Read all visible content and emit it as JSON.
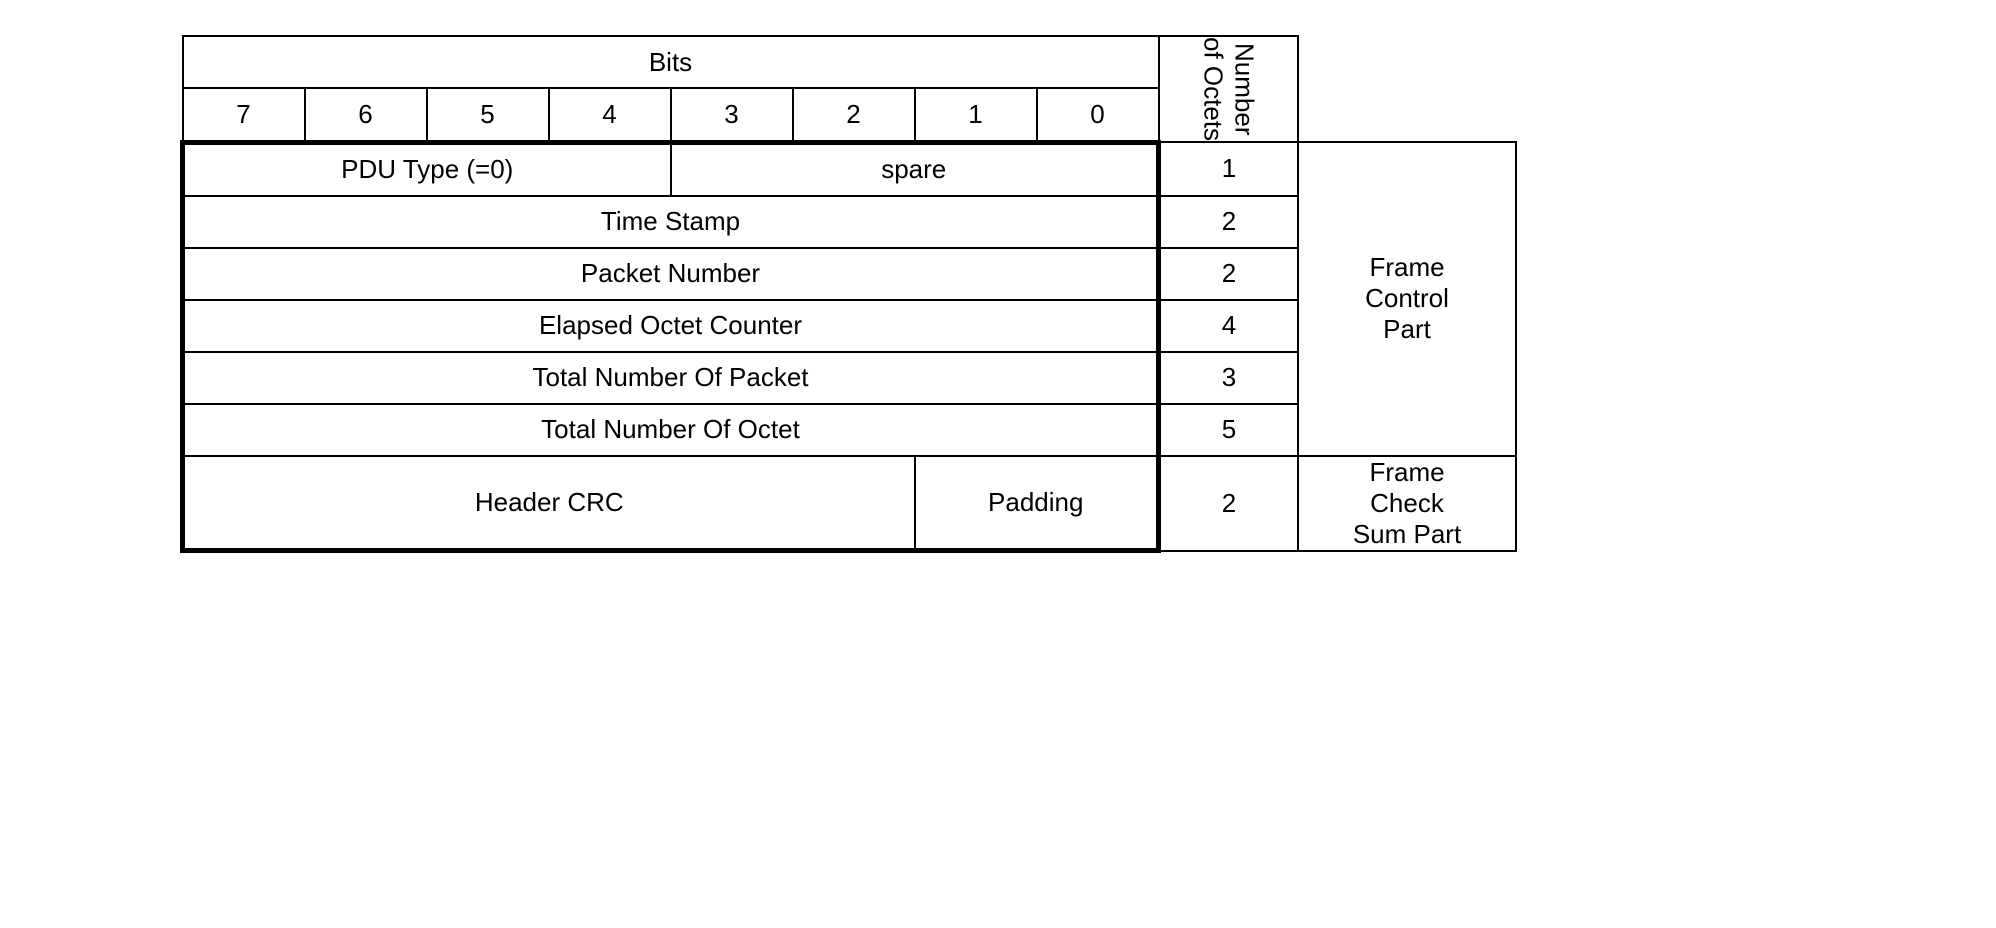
{
  "header": {
    "bits_label": "Bits",
    "bit_numbers": [
      "7",
      "6",
      "5",
      "4",
      "3",
      "2",
      "1",
      "0"
    ],
    "num_octets_label": "Number\nof Octets"
  },
  "rows": [
    {
      "cells": [
        {
          "label": "PDU Type (=0)",
          "span": 4
        },
        {
          "label": "spare",
          "span": 4
        }
      ],
      "octets": "1"
    },
    {
      "cells": [
        {
          "label": "Time Stamp",
          "span": 8
        }
      ],
      "octets": "2"
    },
    {
      "cells": [
        {
          "label": "Packet Number",
          "span": 8
        }
      ],
      "octets": "2"
    },
    {
      "cells": [
        {
          "label": "Elapsed Octet Counter",
          "span": 8
        }
      ],
      "octets": "4"
    },
    {
      "cells": [
        {
          "label": "Total Number Of Packet",
          "span": 8
        }
      ],
      "octets": "3"
    },
    {
      "cells": [
        {
          "label": "Total Number Of Octet",
          "span": 8
        }
      ],
      "octets": "5"
    },
    {
      "cells": [
        {
          "label": "Header CRC",
          "span": 6
        },
        {
          "label": "Padding",
          "span": 2
        }
      ],
      "octets": "2"
    }
  ],
  "parts": [
    {
      "label": "Frame\nControl\nPart",
      "rowspan": 6
    },
    {
      "label": "Frame\nCheck\nSum Part",
      "rowspan": 1
    }
  ]
}
